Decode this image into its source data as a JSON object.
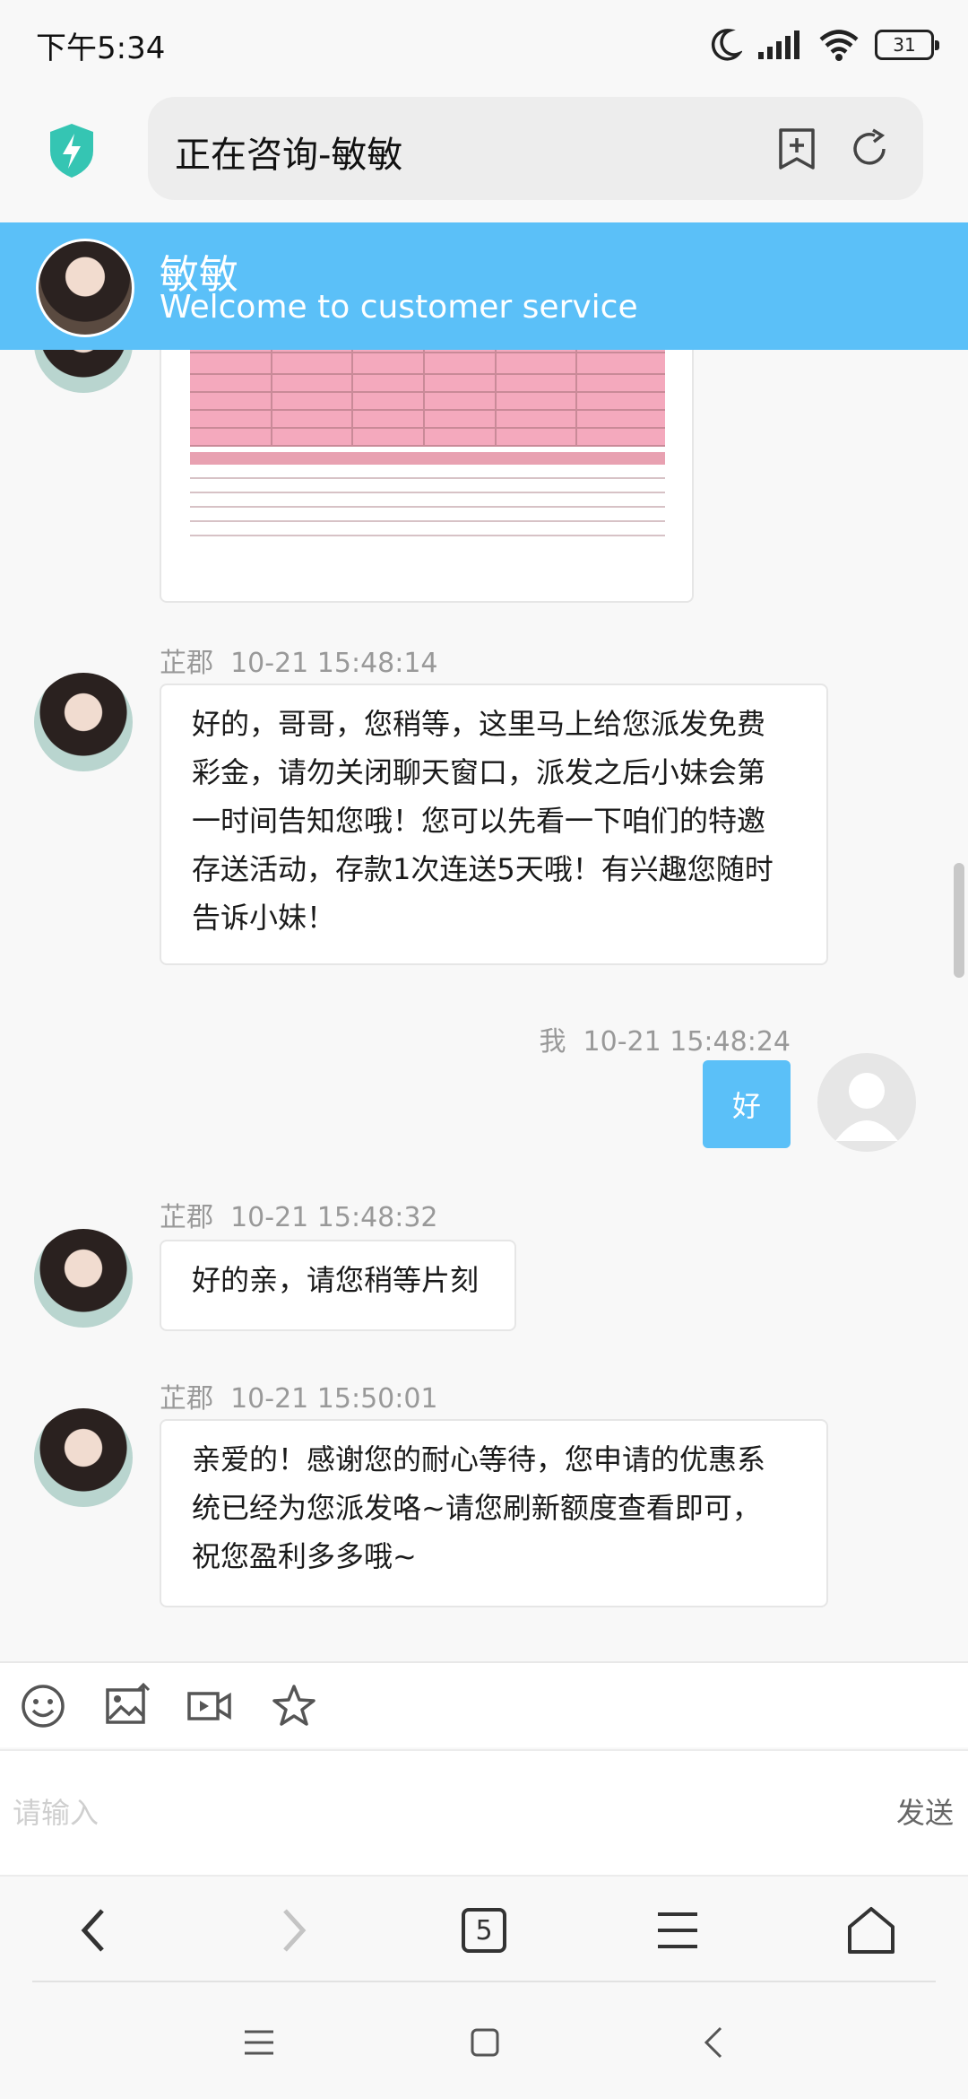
{
  "status_bar": {
    "time": "下午5:34",
    "battery": "31"
  },
  "browser": {
    "page_title": "正在咨询-敏敏",
    "tab_count": "5"
  },
  "chat_header": {
    "agent_name": "敏敏",
    "subtitle": "Welcome to customer service"
  },
  "messages": [
    {
      "sender": "芷郡",
      "time": "10-21 15:48:14",
      "lines": [
        "好的，哥哥，您稍等，这里马上给您派发免费",
        "彩金，请勿关闭聊天窗口，派发之后小妹会第",
        "一时间告知您哦！您可以先看一下咱们的特邀",
        "存送活动，存款1次连送5天哦！有兴趣您随时",
        "告诉小妹！"
      ]
    },
    {
      "sender": "我",
      "time": "10-21 15:48:24",
      "text": "好"
    },
    {
      "sender": "芷郡",
      "time": "10-21 15:48:32",
      "text": "好的亲，请您稍等片刻"
    },
    {
      "sender": "芷郡",
      "time": "10-21 15:50:01",
      "lines": [
        "亲爱的！感谢您的耐心等待，您申请的优惠系",
        "统已经为您派发咯~请您刷新额度查看即可，",
        "祝您盈利多多哦~"
      ]
    }
  ],
  "input": {
    "placeholder": "请输入",
    "send_label": "发送"
  },
  "colors": {
    "accent": "#5bc0f8",
    "bubble_border": "#e6e6e6",
    "meta_text": "#999999"
  }
}
